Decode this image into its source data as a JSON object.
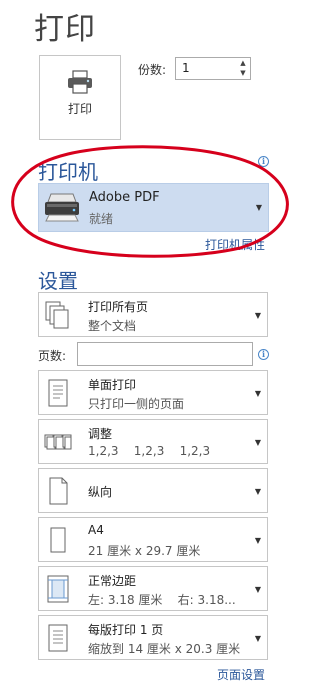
{
  "title": "打印",
  "print_button": {
    "label": "打印",
    "icon": "printer-icon"
  },
  "copies": {
    "label": "份数:",
    "value": "1"
  },
  "printer_section": {
    "heading": "打印机",
    "info_icon": "i",
    "selected": {
      "name": "Adobe PDF",
      "status": "就绪",
      "icon": "printer-icon"
    },
    "properties_link": "打印机属性"
  },
  "settings_section": {
    "heading": "设置",
    "options": [
      {
        "icon": "pages-icon",
        "line1": "打印所有页",
        "line2": "整个文档"
      },
      {
        "icon": "one-sided-icon",
        "line1": "单面打印",
        "line2": "只打印一侧的页面"
      },
      {
        "icon": "collate-icon",
        "line1": "调整",
        "line2": "1,2,3    1,2,3    1,2,3"
      },
      {
        "icon": "portrait-icon",
        "line1": "纵向",
        "line2": ""
      },
      {
        "icon": "paper-size-icon",
        "line1": "A4",
        "line2": "21 厘米 x 29.7 厘米"
      },
      {
        "icon": "margins-icon",
        "line1": "正常边距",
        "line2": "左: 3.18 厘米    右: 3.18..."
      },
      {
        "icon": "pages-per-sheet-icon",
        "line1": "每版打印 1 页",
        "line2": "缩放到 14 厘米 x 20.3 厘米"
      }
    ],
    "pages_field": {
      "label": "页数:",
      "value": "",
      "info_icon": "i"
    },
    "page_setup_link": "页面设置"
  },
  "annotation_color": "#d6001c",
  "accent": "#2b579a"
}
